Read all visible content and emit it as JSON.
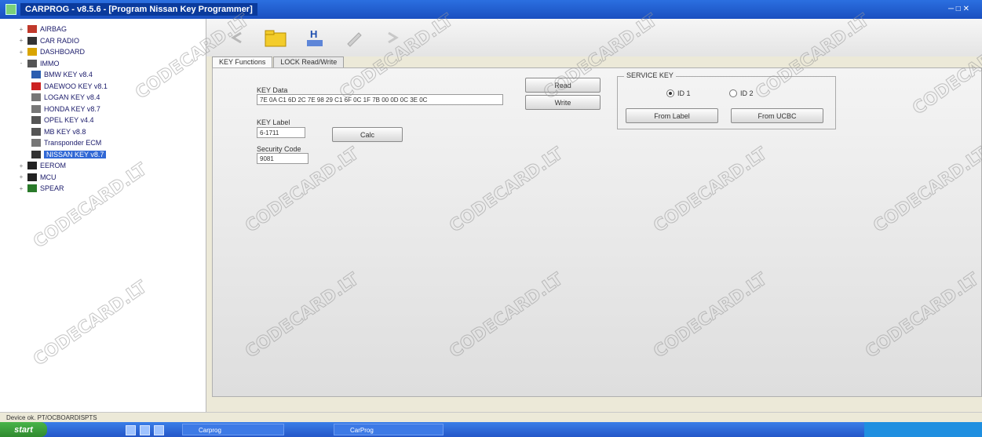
{
  "window": {
    "title": "CARPROG - v8.5.6 - [Program Nissan Key Programmer]"
  },
  "sidebar": {
    "items": [
      {
        "label": "AIRBAG",
        "level": 0,
        "toggle": "+",
        "icon": "airbag-icon",
        "color": "#c0392b"
      },
      {
        "label": "CAR RADIO",
        "level": 0,
        "toggle": "+",
        "icon": "radio-icon",
        "color": "#333333"
      },
      {
        "label": "DASHBOARD",
        "level": 0,
        "toggle": "+",
        "icon": "dashboard-icon",
        "color": "#d9a400"
      },
      {
        "label": "IMMO",
        "level": 0,
        "toggle": "-",
        "icon": "immo-icon",
        "color": "#555555"
      },
      {
        "label": "BMW KEY v8.4",
        "level": 1,
        "toggle": "",
        "icon": "key-icon",
        "color": "#2a5db0"
      },
      {
        "label": "DAEWOO KEY v8.1",
        "level": 1,
        "toggle": "",
        "icon": "key-icon",
        "color": "#cc2222"
      },
      {
        "label": "LOGAN KEY v8.4",
        "level": 1,
        "toggle": "",
        "icon": "key-icon",
        "color": "#777777"
      },
      {
        "label": "HONDA KEY v8.7",
        "level": 1,
        "toggle": "",
        "icon": "key-icon",
        "color": "#777777"
      },
      {
        "label": "OPEL KEY v4.4",
        "level": 1,
        "toggle": "",
        "icon": "key-icon",
        "color": "#555555"
      },
      {
        "label": "MB KEY v8.8",
        "level": 1,
        "toggle": "",
        "icon": "key-icon",
        "color": "#555555"
      },
      {
        "label": "Transponder ECM",
        "level": 1,
        "toggle": "",
        "icon": "key-icon",
        "color": "#777777"
      },
      {
        "label": "NISSAN KEY v8.7",
        "level": 1,
        "toggle": "",
        "icon": "key-icon",
        "color": "#333333",
        "selected": true
      },
      {
        "label": "EEROM",
        "level": 0,
        "toggle": "+",
        "icon": "chip-icon",
        "color": "#222222"
      },
      {
        "label": "MCU",
        "level": 0,
        "toggle": "+",
        "icon": "chip-icon",
        "color": "#222222"
      },
      {
        "label": "SPEAR",
        "level": 0,
        "toggle": "+",
        "icon": "tool-icon",
        "color": "#2a7a2a"
      }
    ]
  },
  "toolbar": {
    "buttons": [
      {
        "icon": "back-arrow-icon"
      },
      {
        "icon": "open-folder-icon"
      },
      {
        "icon": "hex-editor-icon"
      },
      {
        "icon": "write-icon"
      },
      {
        "icon": "forward-arrow-icon"
      }
    ]
  },
  "tabs": [
    {
      "label": "KEY Functions",
      "active": true
    },
    {
      "label": "LOCK Read/Write",
      "active": false
    }
  ],
  "panel": {
    "key_data_label": "KEY Data",
    "key_data_value": "7E 0A C1 6D 2C 7E 98 29 C1 6F 0C 1F 7B 00 0D 0C 3E 0C",
    "read_button": "Read",
    "write_button": "Write",
    "key_label_label": "KEY Label",
    "key_label_value": "6-1711",
    "calc_button": "Calc",
    "security_code_label": "Security Code",
    "security_code_value": "9081",
    "group_title": "SERVICE KEY",
    "radio_1": "ID 1",
    "radio_2": "ID 2",
    "from_label_button": "From Label",
    "from_ucbc_button": "From UCBC"
  },
  "statusbar": {
    "text": "Device ok. PT/OCBOARDISPTS"
  },
  "taskbar": {
    "start_label": "start",
    "task_1": "Carprog",
    "task_2": "CarProg"
  },
  "watermark": "CODECARD.LT",
  "colors": {
    "title_bar": "#2b6fe0",
    "selection": "#3168d5",
    "taskbar": "#2457c8",
    "start": "#3a9a3a"
  }
}
